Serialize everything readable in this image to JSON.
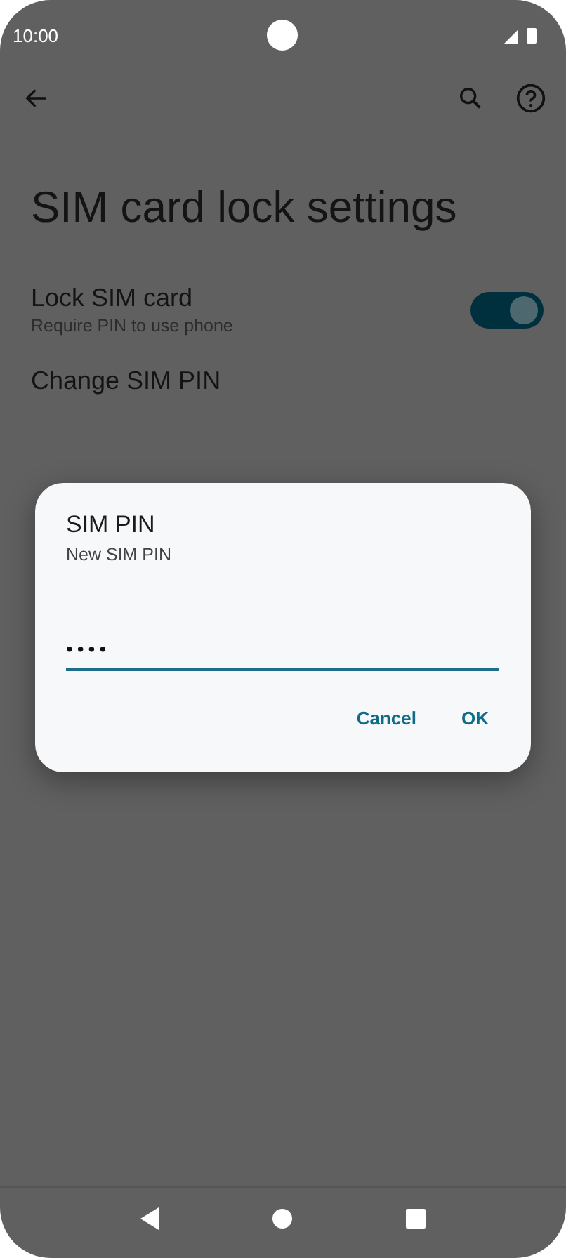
{
  "status_bar": {
    "time": "10:00"
  },
  "page": {
    "title": "SIM card lock settings"
  },
  "settings": [
    {
      "kind": "toggle",
      "label": "Lock SIM card",
      "summary": "Require PIN to use phone",
      "on": true
    },
    {
      "kind": "plain",
      "label": "Change SIM PIN"
    }
  ],
  "dialog": {
    "title": "SIM PIN",
    "message": "New SIM PIN",
    "field": {
      "value": "••••"
    },
    "buttons": [
      "Cancel",
      "OK"
    ]
  }
}
